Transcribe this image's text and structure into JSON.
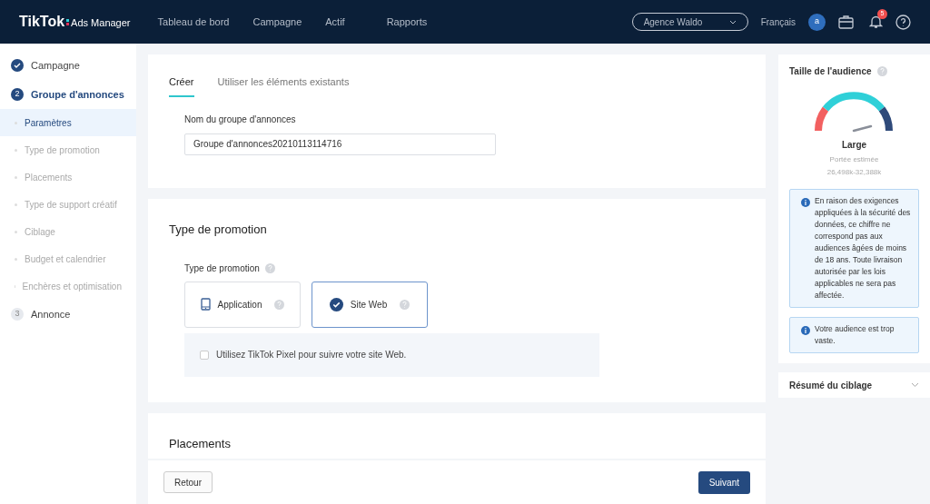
{
  "header": {
    "logo": "TikTok",
    "logo_sub": "Ads Manager",
    "nav": [
      {
        "label": "Tableau de bord"
      },
      {
        "label": "Campagne"
      },
      {
        "label": "Actif"
      },
      {
        "label": "Rapports"
      }
    ],
    "account": "Agence Waldo",
    "language": "Français",
    "avatar": "a",
    "notifications": "5"
  },
  "sidebar": {
    "steps": [
      {
        "label": "Campagne",
        "completed": true,
        "selected": false
      },
      {
        "number": "2",
        "label": "Groupe d'annonces",
        "completed": false,
        "selected": true,
        "children": [
          {
            "label": "Paramètres",
            "selected": true
          },
          {
            "label": "Type de promotion",
            "selected": false
          },
          {
            "label": "Placements",
            "selected": false
          },
          {
            "label": "Type de support créatif",
            "selected": false
          },
          {
            "label": "Ciblage",
            "selected": false
          },
          {
            "label": "Budget et calendrier",
            "selected": false
          },
          {
            "label": "Enchères et optimisation",
            "selected": false
          }
        ]
      },
      {
        "number": "3",
        "label": "Annonce",
        "completed": false,
        "selected": false
      }
    ]
  },
  "create_card": {
    "tabs": [
      {
        "label": "Créer",
        "selected": true
      },
      {
        "label": "Utiliser les éléments existants",
        "selected": false
      }
    ],
    "name_label": "Nom du groupe d'annonces",
    "name_value": "Groupe d'annonces20210113114716"
  },
  "promotion_card": {
    "title": "Type de promotion",
    "field_label": "Type de promotion",
    "options": [
      {
        "label": "Application",
        "kind": "app",
        "selected": false
      },
      {
        "label": "Site Web",
        "kind": "web",
        "selected": true
      }
    ],
    "pixel": {
      "label": "Utilisez TikTok Pixel pour suivre votre site Web.",
      "checked": false
    }
  },
  "placements_card": {
    "title": "Placements"
  },
  "footer": {
    "back": "Retour",
    "next": "Suivant"
  },
  "audience": {
    "title": "Taille de l'audience",
    "size": "Large",
    "reach_label": "Portée estimée",
    "reach": "26,498k-32,388k",
    "notices": [
      "En raison des exigences appliquées à la sécurité des données, ce chiffre ne correspond pas aux audiences âgées de moins de 18 ans. Toute livraison autorisée par les lois applicables ne sera pas affectée.",
      "Votre audience est trop vaste."
    ]
  },
  "summary": {
    "title": "Résumé du ciblage",
    "expanded": false
  }
}
